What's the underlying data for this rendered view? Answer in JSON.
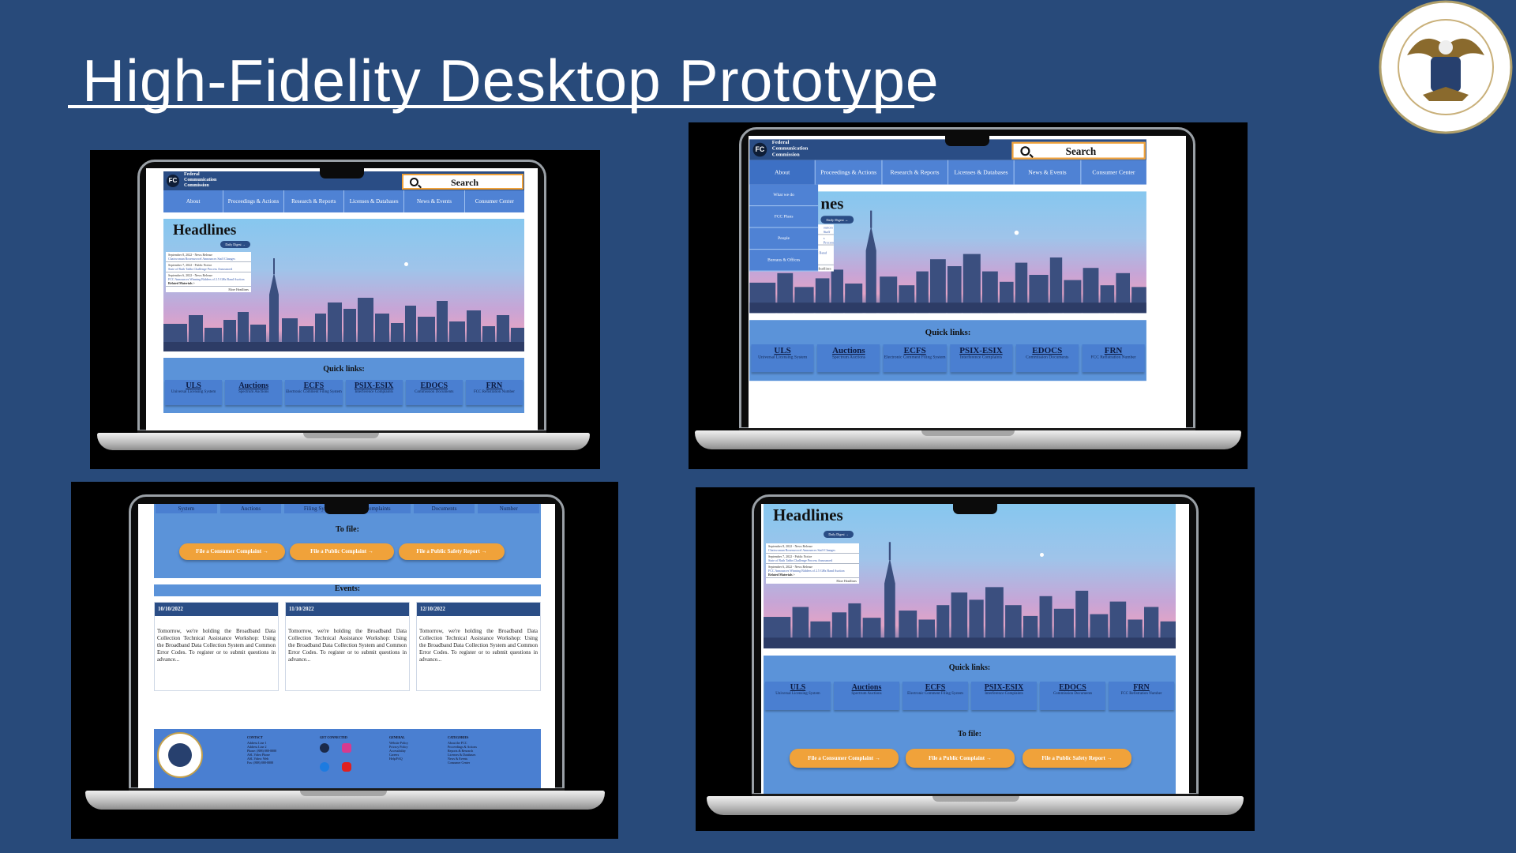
{
  "slide": {
    "title": "High-Fidelity Desktop Prototype",
    "seal_icon": "fcc-seal-icon",
    "background": "#284a7a"
  },
  "site": {
    "agency_line1": "Federal",
    "agency_line2": "Communication",
    "agency_line3": "Commission",
    "logo_text": "FC",
    "search_label": "Search",
    "nav": [
      "About",
      "Proceedings & Actions",
      "Research & Reports",
      "Licenses & Databases",
      "News & Events",
      "Consumer Center"
    ],
    "about_menu": [
      "What we do",
      "FCC Plans",
      "People",
      "Bureaus & Offices"
    ],
    "headlines_title": "Headlines",
    "headlines_partial_title": "nes",
    "daily_digest": "Daily Digest →",
    "headlines": [
      {
        "meta": "September 8, 2022 - News Release",
        "text": "Chairwoman Rosenworcel Announces Staff Changes"
      },
      {
        "meta": "September 7, 2022 - Public Notice",
        "text": "State of Ruth Tahbs Challenge Process Announced"
      },
      {
        "meta": "September 6, 2022 - News Release",
        "text": "FCC Announces Winning Bidders of 2.5 GHz Band Auction"
      }
    ],
    "partial_headline_1": "ounces Staff",
    "partial_headline_2": "s Process",
    "related_materials": "Related Materials >",
    "more_headlines": "More Headlines",
    "quick_links_title": "Quick links:",
    "quick_links": [
      {
        "code": "ULS",
        "desc": "Universal Licensing System"
      },
      {
        "code": "Auctions",
        "desc": "Spectrum Auctions"
      },
      {
        "code": "ECFS",
        "desc": "Electronic Comment Filing System"
      },
      {
        "code": "PSIX-ESIX",
        "desc": "Interference Complaints"
      },
      {
        "code": "EDOCS",
        "desc": "Commission Documents"
      },
      {
        "code": "FRN",
        "desc": "FCC Refistration Number"
      }
    ],
    "scrolled_labels": [
      "System",
      "Auctions",
      "Filing Sys",
      "omplaints",
      "Documents",
      "Number"
    ],
    "to_file_title": "To file:",
    "file_buttons": [
      "File a Consumer Complaint →",
      "File a Public Complaint →",
      "File a Public Safety Report →"
    ],
    "events_title": "Events:",
    "events": [
      {
        "date": "10/10/2022",
        "text": "Tomorrow, we're holding the Broadband Data Collection Technical Assistance Workshop: Using the Broadband Data Collection System and Common Error Codes. To register or to submit questions in advance..."
      },
      {
        "date": "11/10/2022",
        "text": "Tomorrow, we're holding the Broadband Data Collection Technical Assistance Workshop: Using the Broadband Data Collection System and Common Error Codes. To register or to submit questions in advance..."
      },
      {
        "date": "12/10/2022",
        "text": "Tomorrow, we're holding the Broadband Data Collection Technical Assistance Workshop: Using the Broadband Data Collection System and Common Error Codes. To register or to submit questions in advance..."
      }
    ],
    "footer": {
      "contact_title": "CONTACT",
      "contact": [
        "Address Line 1",
        "Address Line 2",
        "Phone: (888) 888-8888",
        "ASL Video Phone",
        "ASL Video: Web",
        "Fax: (888) 888-8888"
      ],
      "connected_title": "GET CONNECTED",
      "general_title": "GENERAL",
      "general": [
        "Website Policy",
        "Privacy Policy",
        "Accessibility",
        "Careers",
        "Help/FAQ"
      ],
      "categories_title": "CATEGORIES",
      "categories": [
        "About the FCC",
        "Proceedings & Actions",
        "Reports & Research",
        "Licenses & Databases",
        "News & Events",
        "Consumer Center"
      ]
    }
  },
  "colors": {
    "header": "#2a4d85",
    "nav": "#4f82d4",
    "section": "#5b93d9",
    "button": "#f0a23a"
  }
}
